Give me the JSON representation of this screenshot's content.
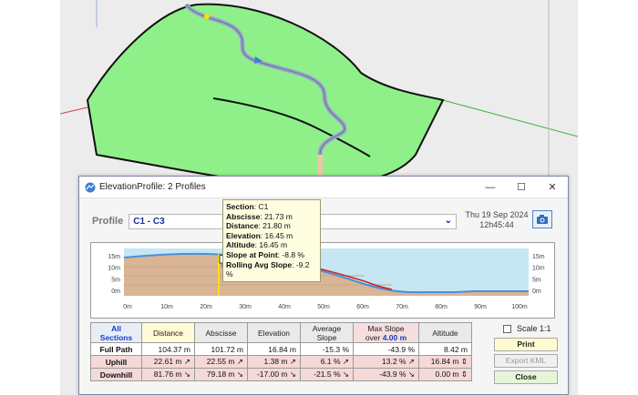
{
  "window": {
    "title": "ElevationProfile: 2 Profiles",
    "minimize": "—",
    "maximize": "☐",
    "close": "✕"
  },
  "profile": {
    "label": "Profile",
    "selected": "C1 - C3"
  },
  "date": {
    "line1": "Thu 19 Sep 2024",
    "line2": "12h45:44"
  },
  "chart": {
    "y_ticks": [
      "15m",
      "10m",
      "5m",
      "0m"
    ],
    "x_ticks": [
      "0m",
      "10m",
      "20m",
      "30m",
      "40m",
      "50m",
      "60m",
      "70m",
      "80m",
      "90m",
      "100m"
    ],
    "colors": {
      "ground": "#d9b596",
      "sky": "#c6e6f3",
      "path": "#4a8fd8",
      "uphill": "#cc2222",
      "marker": "#ffe000"
    }
  },
  "tooltip": {
    "section_label": "Section",
    "section_value": ": C1",
    "abscisse_label": "Abscisse",
    "abscisse_value": ": 21.73 m",
    "distance_label": "Distance",
    "distance_value": ": 21.80 m",
    "elevation_label": "Elevation",
    "elevation_value": ": 16.45 m",
    "altitude_label": "Altitude",
    "altitude_value": ": 16.45 m",
    "slope_label": "Slope at Point",
    "slope_value": ": -8.8 %",
    "rolling_label": "Rolling Avg Slope",
    "rolling_value": ": -9.2 %"
  },
  "table": {
    "headers": {
      "sections_1": "All",
      "sections_2": "Sections",
      "distance": "Distance",
      "abscisse": "Abscisse",
      "elevation": "Elevation",
      "avg_1": "Average",
      "avg_2": "Slope",
      "max_1": "Max Slope",
      "max_2a": "over ",
      "max_2b": "4.00 m",
      "altitude": "Altitude"
    },
    "rows": [
      {
        "label": "Full Path",
        "distance": "104.37 m",
        "abscisse": "101.72 m",
        "elevation": "16.84 m",
        "avg": "-15.3 %",
        "max": "-43.9 %",
        "altitude": "8.42 m"
      },
      {
        "label": "Uphill",
        "distance": "22.61 m ↗",
        "abscisse": "22.55 m ↗",
        "elevation": "1.38 m ↗",
        "avg": "6.1 % ↗",
        "max": "13.2 % ↗",
        "altitude": "16.84 m ⇕"
      },
      {
        "label": "Downhill",
        "distance": "81.76 m ↘",
        "abscisse": "79.18 m ↘",
        "elevation": "-17.00 m ↘",
        "avg": "-21.5 % ↘",
        "max": "-43.9 % ↘",
        "altitude": "0.00 m ⇕"
      }
    ]
  },
  "side": {
    "scale_label": "Scale 1:1",
    "print": "Print",
    "export": "Export KML",
    "close": "Close"
  }
}
